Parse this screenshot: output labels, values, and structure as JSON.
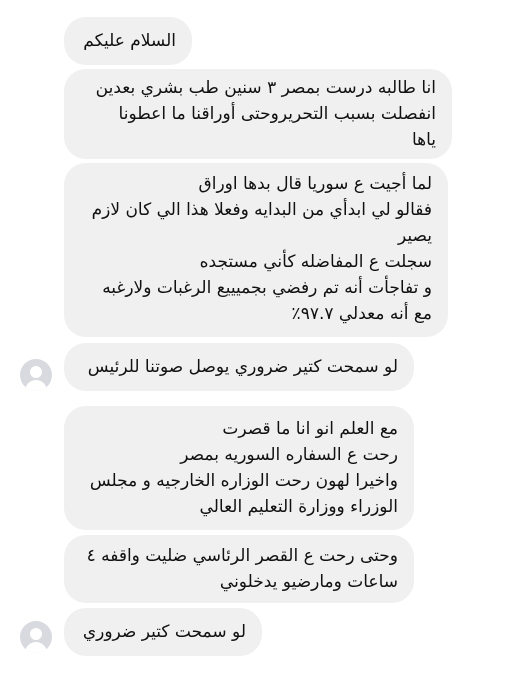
{
  "colors": {
    "bubble_bg": "#f0f0f0",
    "text": "#111111",
    "avatar_bg": "#d8dadf"
  },
  "messages": [
    {
      "lines": [
        "السلام عليكم"
      ]
    },
    {
      "lines": [
        "انا طالبه درست بمصر ٣ سنين طب بشري بعدين",
        "انفصلت بسبب التحريروحتى أوراقنا ما اعطونا",
        "ياها"
      ]
    },
    {
      "lines": [
        "لما أجيت ع سوريا قال بدها اوراق",
        "فقالو لي ابدأي من البدايه وفعلا هذا الي كان لازم",
        "يصير",
        "سجلت ع المفاضله كأني مستجده",
        "و تفاجأت أنه تم رفضي بجميييع الرغبات ولارغبه",
        "مع أنه معدلي ٩٧.٧٪"
      ]
    },
    {
      "lines": [
        "لو سمحت كتير ضروري يوصل صوتنا للرئيس"
      ]
    },
    {
      "lines": [
        "مع العلم انو انا ما قصرت",
        "رحت ع السفاره السوريه بمصر",
        "واخيرا لهون رحت الوزاره الخارجيه و مجلس",
        "الوزراء ووزارة التعليم العالي"
      ]
    },
    {
      "lines": [
        "وحتى رحت ع القصر الرئاسي ضليت واقفه ٤",
        "ساعات ومارضيو يدخلوني"
      ]
    },
    {
      "lines": [
        "لو سمحت كتير ضروري"
      ]
    }
  ],
  "avatars": [
    {
      "icon": "default-user-avatar-icon"
    },
    {
      "icon": "default-user-avatar-icon"
    }
  ]
}
